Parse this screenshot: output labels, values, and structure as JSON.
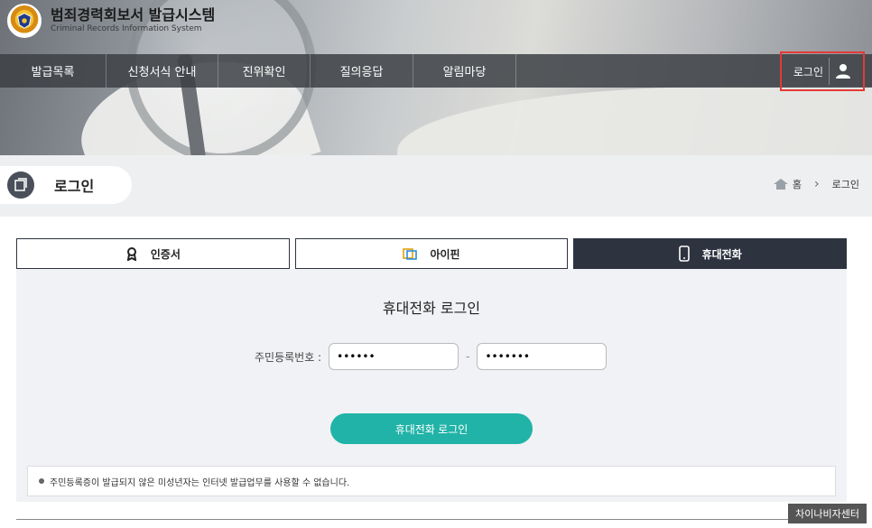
{
  "brand": {
    "title": "범죄경력회보서 발급시스템",
    "subtitle": "Criminal Records Information System"
  },
  "nav": {
    "items": [
      "발급목록",
      "신청서식 안내",
      "진위확인",
      "질의응답",
      "알림마당"
    ],
    "login_label": "로그인"
  },
  "page": {
    "title": "로그인",
    "breadcrumb": {
      "home": "홈",
      "current": "로그인"
    }
  },
  "tabs": [
    {
      "label": "인증서",
      "icon": "certificate-icon"
    },
    {
      "label": "아이핀",
      "icon": "ipin-icon"
    },
    {
      "label": "휴대전화",
      "icon": "phone-icon",
      "active": true
    }
  ],
  "panel": {
    "heading": "휴대전화 로그인",
    "id_label": "주민등록번호 :",
    "id_front_value": "••••••",
    "id_back_value": "•••••••",
    "dash": "-",
    "login_button": "휴대전화 로그인",
    "notice": "주민등록증이 발급되지 않은 미성년자는 인터넷 발급업무를 사용할 수 없습니다."
  },
  "watermark": "차이나비자센터",
  "colors": {
    "accent": "#21b3a7",
    "tab_active": "#2e3340",
    "highlight_box": "#e53935"
  }
}
